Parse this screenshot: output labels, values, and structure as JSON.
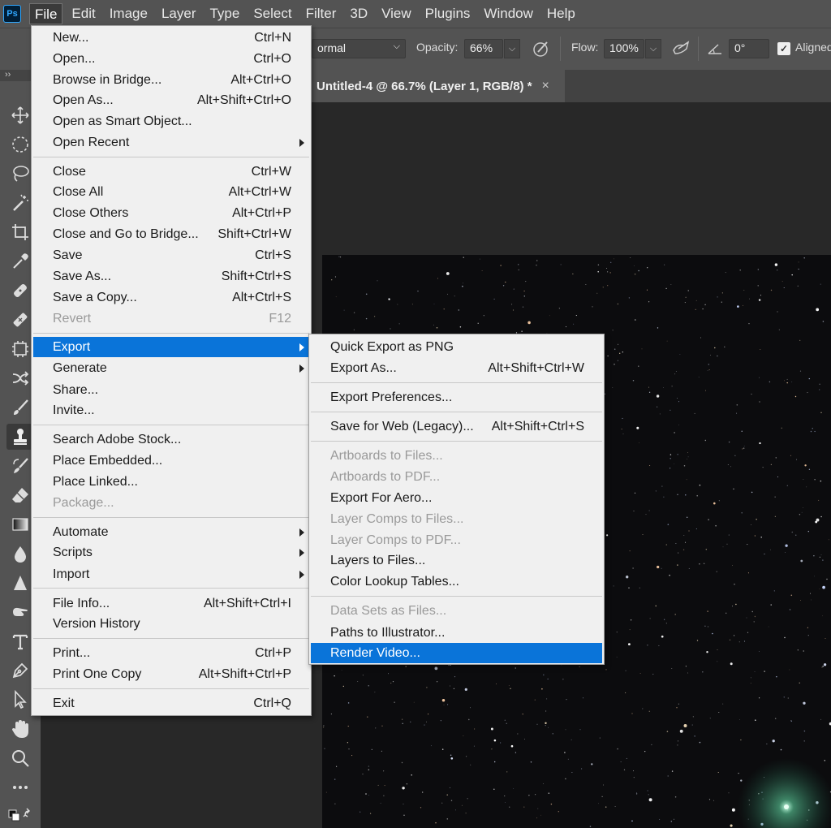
{
  "menubar": {
    "logo": "Ps",
    "items": [
      "File",
      "Edit",
      "Image",
      "Layer",
      "Type",
      "Select",
      "Filter",
      "3D",
      "View",
      "Plugins",
      "Window",
      "Help"
    ],
    "active_index": 0
  },
  "options_bar": {
    "mode_value": "ormal",
    "opacity_label": "Opacity:",
    "opacity_value": "66%",
    "flow_label": "Flow:",
    "flow_value": "100%",
    "angle_value": "0°",
    "aligned_label": "Aligned",
    "aligned_checked": true
  },
  "tool_panel": {
    "expand_glyph": "››",
    "tools": [
      "move-tool-icon",
      "marquee-tool-icon",
      "lasso-tool-icon",
      "magic-wand-tool-icon",
      "crop-tool-icon",
      "eyedropper-tool-icon",
      "spot-healing-tool-icon",
      "healing-brush-tool-icon",
      "patch-tool-icon",
      "content-aware-move-tool-icon",
      "brush-tool-icon",
      "clone-stamp-tool-icon",
      "history-brush-tool-icon",
      "eraser-tool-icon",
      "gradient-tool-icon",
      "blur-tool-icon",
      "sharpen-tool-icon",
      "smudge-tool-icon",
      "type-tool-icon",
      "pen-tool-icon",
      "path-selection-tool-icon",
      "hand-tool-icon",
      "zoom-tool-icon",
      "more-tools-icon",
      "default-colors-icon"
    ],
    "active_tool": "clone-stamp-tool-icon"
  },
  "document": {
    "tab_title": "Untitled-4 @ 66.7% (Layer 1, RGB/8) *",
    "close_glyph": "×"
  },
  "file_menu": {
    "items": [
      {
        "label": "New...",
        "shortcut": "Ctrl+N"
      },
      {
        "label": "Open...",
        "shortcut": "Ctrl+O"
      },
      {
        "label": "Browse in Bridge...",
        "shortcut": "Alt+Ctrl+O"
      },
      {
        "label": "Open As...",
        "shortcut": "Alt+Shift+Ctrl+O"
      },
      {
        "label": "Open as Smart Object...",
        "shortcut": ""
      },
      {
        "label": "Open Recent",
        "shortcut": "",
        "submenu": true
      },
      {
        "label": "Close",
        "shortcut": "Ctrl+W"
      },
      {
        "label": "Close All",
        "shortcut": "Alt+Ctrl+W"
      },
      {
        "label": "Close Others",
        "shortcut": "Alt+Ctrl+P"
      },
      {
        "label": "Close and Go to Bridge...",
        "shortcut": "Shift+Ctrl+W"
      },
      {
        "label": "Save",
        "shortcut": "Ctrl+S"
      },
      {
        "label": "Save As...",
        "shortcut": "Shift+Ctrl+S"
      },
      {
        "label": "Save a Copy...",
        "shortcut": "Alt+Ctrl+S"
      },
      {
        "label": "Revert",
        "shortcut": "F12",
        "disabled": true
      },
      {
        "label": "Export",
        "shortcut": "",
        "submenu": true,
        "highlighted": true
      },
      {
        "label": "Generate",
        "shortcut": "",
        "submenu": true
      },
      {
        "label": "Share...",
        "shortcut": ""
      },
      {
        "label": "Invite...",
        "shortcut": ""
      },
      {
        "label": "Search Adobe Stock...",
        "shortcut": ""
      },
      {
        "label": "Place Embedded...",
        "shortcut": ""
      },
      {
        "label": "Place Linked...",
        "shortcut": ""
      },
      {
        "label": "Package...",
        "shortcut": "",
        "disabled": true
      },
      {
        "label": "Automate",
        "shortcut": "",
        "submenu": true
      },
      {
        "label": "Scripts",
        "shortcut": "",
        "submenu": true
      },
      {
        "label": "Import",
        "shortcut": "",
        "submenu": true
      },
      {
        "label": "File Info...",
        "shortcut": "Alt+Shift+Ctrl+I"
      },
      {
        "label": "Version History",
        "shortcut": ""
      },
      {
        "label": "Print...",
        "shortcut": "Ctrl+P"
      },
      {
        "label": "Print One Copy",
        "shortcut": "Alt+Shift+Ctrl+P"
      },
      {
        "label": "Exit",
        "shortcut": "Ctrl+Q"
      }
    ]
  },
  "export_menu": {
    "items": [
      {
        "label": "Quick Export as PNG",
        "shortcut": ""
      },
      {
        "label": "Export As...",
        "shortcut": "Alt+Shift+Ctrl+W"
      },
      {
        "label": "Export Preferences...",
        "shortcut": ""
      },
      {
        "label": "Save for Web (Legacy)...",
        "shortcut": "Alt+Shift+Ctrl+S"
      },
      {
        "label": "Artboards to Files...",
        "shortcut": "",
        "disabled": true
      },
      {
        "label": "Artboards to PDF...",
        "shortcut": "",
        "disabled": true
      },
      {
        "label": "Export For Aero...",
        "shortcut": ""
      },
      {
        "label": "Layer Comps to Files...",
        "shortcut": "",
        "disabled": true
      },
      {
        "label": "Layer Comps to PDF...",
        "shortcut": "",
        "disabled": true
      },
      {
        "label": "Layers to Files...",
        "shortcut": ""
      },
      {
        "label": "Color Lookup Tables...",
        "shortcut": ""
      },
      {
        "label": "Data Sets as Files...",
        "shortcut": "",
        "disabled": true
      },
      {
        "label": "Paths to Illustrator...",
        "shortcut": ""
      },
      {
        "label": "Render Video...",
        "shortcut": "",
        "highlighted": true
      }
    ]
  },
  "colors": {
    "highlight": "#0a74d9",
    "menu_bg": "#f0f0f0",
    "chrome": "#535353",
    "workspace": "#282828"
  }
}
